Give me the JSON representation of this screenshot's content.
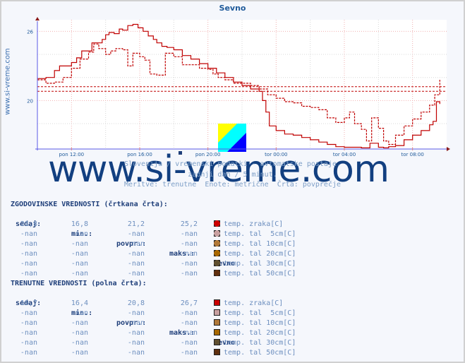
{
  "chart_data": {
    "type": "line",
    "title": "Sevno",
    "xlabel": "",
    "ylabel": "",
    "side_label": "www.si-vreme.com",
    "yticks": [
      20,
      26
    ],
    "ylim": [
      15.8,
      27.0
    ],
    "xlim_hours": [
      10.0,
      34.0
    ],
    "xticks": [
      {
        "h": 12,
        "label": "pon 12:00"
      },
      {
        "h": 16,
        "label": "pon 16:00"
      },
      {
        "h": 20,
        "label": "pon 20:00"
      },
      {
        "h": 24,
        "label": "tor 00:00"
      },
      {
        "h": 28,
        "label": "tor 04:00"
      },
      {
        "h": 32,
        "label": "tor 08:00"
      }
    ],
    "grid": true,
    "hlines": [
      {
        "name": "historical-average",
        "value": 21.2
      },
      {
        "name": "current-average",
        "value": 20.8
      }
    ],
    "series": [
      {
        "name": "temp. zraka [C] (trenutne, polna črta)",
        "style": "solid",
        "x": [
          10.0,
          10.5,
          11.0,
          11.3,
          11.6,
          12.0,
          12.3,
          12.6,
          12.9,
          13.2,
          13.5,
          13.8,
          14.0,
          14.2,
          14.5,
          14.8,
          15.0,
          15.3,
          15.6,
          15.9,
          16.2,
          16.5,
          16.8,
          17.0,
          17.3,
          17.6,
          18.0,
          18.5,
          19.0,
          19.5,
          20.0,
          20.5,
          21.0,
          21.5,
          22.0,
          22.5,
          23.0,
          23.2,
          23.4,
          23.6,
          24.0,
          24.5,
          25.0,
          25.5,
          26.0,
          26.5,
          27.0,
          27.5,
          28.0,
          28.5,
          29.0,
          29.5,
          30.0,
          30.3,
          30.6,
          31.0,
          31.5,
          32.0,
          32.5,
          33.0,
          33.2,
          33.4,
          33.6
        ],
        "y": [
          21.9,
          22.0,
          22.6,
          23.0,
          23.0,
          23.3,
          23.7,
          24.3,
          24.3,
          25.0,
          25.0,
          25.3,
          25.7,
          25.9,
          25.8,
          26.2,
          26.1,
          26.5,
          26.6,
          26.3,
          26.0,
          25.6,
          25.3,
          25.0,
          24.7,
          24.6,
          24.4,
          23.9,
          23.6,
          23.2,
          22.8,
          22.4,
          22.0,
          21.6,
          21.3,
          21.0,
          20.8,
          20.0,
          19.0,
          17.8,
          17.4,
          17.1,
          17.0,
          16.8,
          16.6,
          16.4,
          16.2,
          16.0,
          15.95,
          15.95,
          15.9,
          16.3,
          15.95,
          15.9,
          16.0,
          16.1,
          16.6,
          17.0,
          17.4,
          17.9,
          18.2,
          19.9,
          19.7
        ]
      },
      {
        "name": "temp. zraka [C] (zgodovinske, črtkana črta)",
        "style": "dashed",
        "x": [
          10.0,
          10.5,
          11.0,
          11.5,
          12.0,
          12.5,
          13.0,
          13.3,
          13.6,
          14.0,
          14.3,
          14.6,
          15.0,
          15.3,
          15.6,
          16.0,
          16.3,
          16.6,
          17.0,
          17.5,
          18.0,
          18.5,
          19.0,
          19.5,
          20.0,
          20.3,
          20.6,
          21.0,
          21.5,
          22.0,
          22.5,
          23.0,
          23.5,
          24.0,
          24.5,
          25.0,
          25.5,
          26.0,
          26.5,
          27.0,
          27.5,
          28.0,
          28.3,
          28.6,
          29.0,
          29.3,
          29.6,
          30.0,
          30.3,
          30.6,
          31.0,
          31.5,
          32.0,
          32.5,
          33.0,
          33.3,
          33.6
        ],
        "y": [
          21.8,
          21.5,
          21.6,
          22.0,
          22.8,
          23.6,
          24.2,
          24.9,
          24.5,
          24.0,
          24.3,
          24.5,
          24.4,
          23.0,
          24.1,
          23.8,
          23.5,
          22.3,
          22.2,
          24.1,
          23.8,
          23.1,
          23.1,
          22.8,
          22.7,
          22.3,
          22.0,
          21.8,
          21.5,
          21.5,
          21.3,
          21.0,
          20.5,
          20.2,
          19.9,
          19.8,
          19.5,
          19.4,
          19.2,
          18.5,
          18.1,
          18.5,
          19.0,
          18.0,
          17.5,
          16.5,
          18.5,
          17.6,
          16.5,
          16.2,
          17.0,
          17.8,
          18.4,
          19.0,
          19.6,
          20.5,
          21.8
        ]
      }
    ],
    "line_color": "#c00000",
    "axis_color": "#5a5ae6"
  },
  "watermark": "www.si-vreme.com",
  "subtitle": {
    "line1": "Slovenija / vremenski podatki - avtomatske postaje.",
    "line2": "zadnji dan / 5 minut.",
    "line3": "Meritve: trenutne  Enote: metrične  Črta: povprečje"
  },
  "historical": {
    "heading": "ZGODOVINSKE VREDNOSTI (črtkana črta):",
    "columns": [
      "sedaj:",
      "min.:",
      "povpr.:",
      "maks.:"
    ],
    "station": "Sevno",
    "rows": [
      {
        "values": [
          "21,8",
          "16,8",
          "21,2",
          "25,2"
        ],
        "label": "temp. zraka[C]",
        "color": "#cc0000"
      },
      {
        "values": [
          "-nan",
          "-nan",
          "-nan",
          "-nan"
        ],
        "label": "temp. tal  5cm[C]",
        "color": "#c8a0a0"
      },
      {
        "values": [
          "-nan",
          "-nan",
          "-nan",
          "-nan"
        ],
        "label": "temp. tal 10cm[C]",
        "color": "#b07838"
      },
      {
        "values": [
          "-nan",
          "-nan",
          "-nan",
          "-nan"
        ],
        "label": "temp. tal 20cm[C]",
        "color": "#a86800"
      },
      {
        "values": [
          "-nan",
          "-nan",
          "-nan",
          "-nan"
        ],
        "label": "temp. tal 30cm[C]",
        "color": "#605030"
      },
      {
        "values": [
          "-nan",
          "-nan",
          "-nan",
          "-nan"
        ],
        "label": "temp. tal 50cm[C]",
        "color": "#603010"
      }
    ]
  },
  "current": {
    "heading": "TRENUTNE VREDNOSTI (polna črta):",
    "columns": [
      "sedaj:",
      "min.:",
      "povpr.:",
      "maks.:"
    ],
    "station": "Sevno",
    "rows": [
      {
        "values": [
          "19,7",
          "16,4",
          "20,8",
          "26,7"
        ],
        "label": "temp. zraka[C]",
        "color": "#cc0000"
      },
      {
        "values": [
          "-nan",
          "-nan",
          "-nan",
          "-nan"
        ],
        "label": "temp. tal  5cm[C]",
        "color": "#c8a0a0"
      },
      {
        "values": [
          "-nan",
          "-nan",
          "-nan",
          "-nan"
        ],
        "label": "temp. tal 10cm[C]",
        "color": "#b07838"
      },
      {
        "values": [
          "-nan",
          "-nan",
          "-nan",
          "-nan"
        ],
        "label": "temp. tal 20cm[C]",
        "color": "#a86800"
      },
      {
        "values": [
          "-nan",
          "-nan",
          "-nan",
          "-nan"
        ],
        "label": "temp. tal 30cm[C]",
        "color": "#605030"
      },
      {
        "values": [
          "-nan",
          "-nan",
          "-nan",
          "-nan"
        ],
        "label": "temp. tal 50cm[C]",
        "color": "#603010"
      }
    ]
  }
}
